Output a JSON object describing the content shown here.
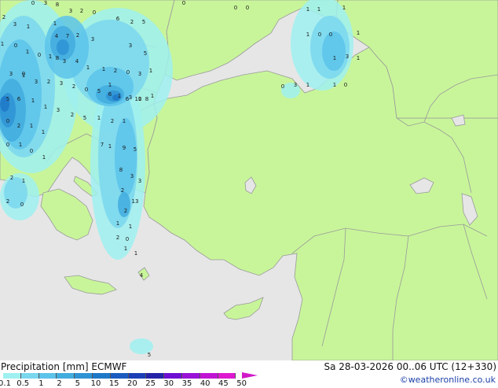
{
  "footer": {
    "title_left": "Precipitation [mm]  ECMWF",
    "title_right": "Sa 28-03-2026 00..06 UTC (12+330)",
    "credit": "©weatheronline.co.uk"
  },
  "legend": {
    "ticks": [
      "0.1",
      "0.5",
      "1",
      "2",
      "5",
      "10",
      "15",
      "20",
      "25",
      "30",
      "35",
      "40",
      "45",
      "50"
    ],
    "colors": [
      "#9ff0f0",
      "#7ad7ee",
      "#5cc3ea",
      "#42acde",
      "#2f93d3",
      "#1e78c8",
      "#1c5cc0",
      "#1c3fb6",
      "#2424a8",
      "#6e0ed2",
      "#9a12d6",
      "#c016d4",
      "#de1ad0"
    ]
  },
  "map_colors": {
    "sea": "#e6e6e6",
    "land": "#c8f59a",
    "border": "#9a9a9a"
  },
  "values": [
    "0",
    "3",
    "8",
    "3",
    "2",
    "0",
    "2",
    "3",
    "1",
    "1",
    "2",
    "3",
    "6",
    "2",
    "5",
    "4",
    "7",
    "1",
    "0",
    "1",
    "0",
    "1",
    "3",
    "4",
    "1",
    "1",
    "2",
    "0",
    "3",
    "1",
    "3",
    "1",
    "3",
    "2",
    "3",
    "2",
    "0",
    "5",
    "6",
    "1",
    "6",
    "1",
    "1",
    "5",
    "6",
    "1",
    "1",
    "3",
    "2",
    "5",
    "1",
    "2",
    "1",
    "0",
    "2",
    "1",
    "1",
    "8",
    "3",
    "5",
    "0",
    "1",
    "3",
    "10",
    "8",
    "0",
    "1",
    "0",
    "1",
    "7",
    "1",
    "9",
    "5",
    "8",
    "3",
    "3",
    "2",
    "1",
    "2",
    "13",
    "2",
    "1",
    "1",
    "1",
    "1",
    "4",
    "2",
    "0",
    "0",
    "1",
    "1",
    "1",
    "1",
    "0",
    "0",
    "1",
    "1",
    "3",
    "1",
    "0",
    "3",
    "1",
    "1",
    "0",
    "0",
    "2",
    "0",
    "0",
    "5",
    "0",
    "0",
    "0",
    "1"
  ]
}
